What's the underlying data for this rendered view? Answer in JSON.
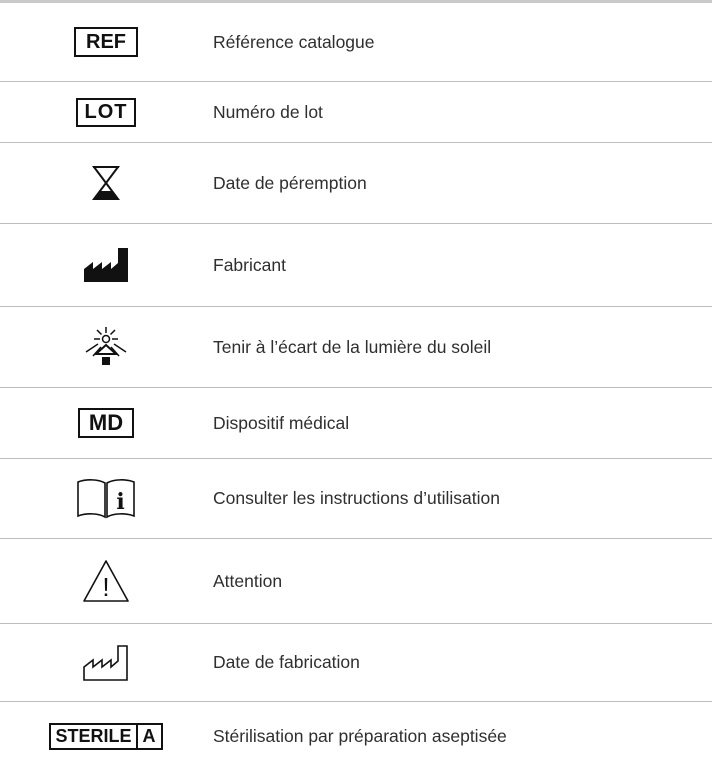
{
  "symbols": [
    {
      "symbol_text": "REF",
      "icon": "ref-box-icon",
      "label": "Référence catalogue"
    },
    {
      "symbol_text": "LOT",
      "icon": "lot-box-icon",
      "label": "Numéro de lot"
    },
    {
      "icon": "hourglass-icon",
      "label": "Date de péremption"
    },
    {
      "icon": "factory-filled-icon",
      "label": "Fabricant"
    },
    {
      "icon": "sun-protect-icon",
      "label": "Tenir à l’écart de la lumière du soleil"
    },
    {
      "symbol_text": "MD",
      "icon": "md-box-icon",
      "label": "Dispositif médical"
    },
    {
      "symbol_text": "i",
      "icon": "ifu-book-icon",
      "label": "Consulter les instructions d’utilisation"
    },
    {
      "symbol_text": "!",
      "icon": "warning-triangle-icon",
      "label": "Attention"
    },
    {
      "icon": "factory-outline-icon",
      "label": "Date de fabrication"
    },
    {
      "symbol_text": "STERILE",
      "symbol_suffix": "A",
      "icon": "sterile-a-icon",
      "label": "Stérilisation par préparation aseptisée"
    }
  ]
}
